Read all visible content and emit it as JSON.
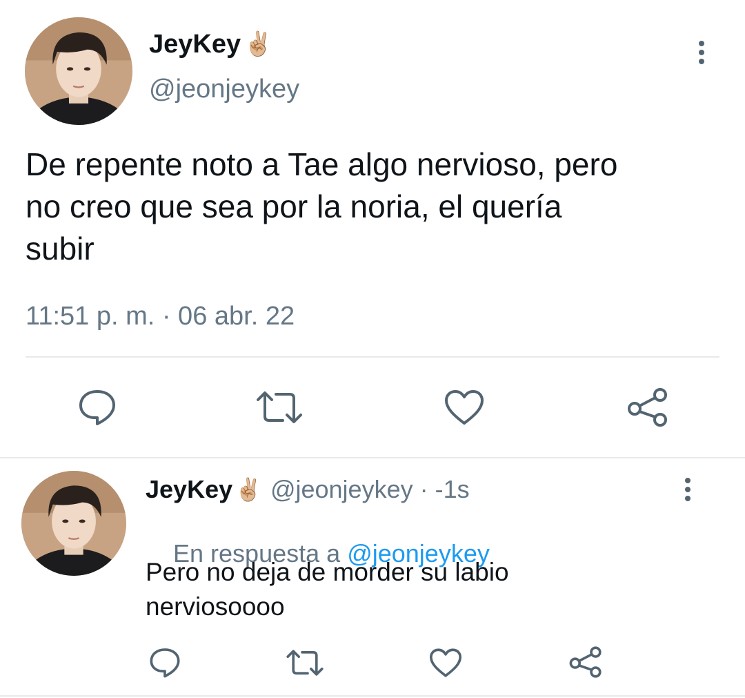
{
  "main_tweet": {
    "display_name": "JeyKey",
    "name_emoji": "✌🏼",
    "handle": "@jeonjeykey",
    "text_lines": [
      "De repente noto a Tae algo nervioso, pero",
      "no creo que sea por la noria, el quería",
      "subir"
    ],
    "timestamp": "11:51 p. m. · 06 abr. 22"
  },
  "reply_tweet": {
    "display_name": "JeyKey",
    "name_emoji": "✌🏼",
    "handle": "@jeonjeykey",
    "time": " · -1s",
    "in_reply_prefix": "En respuesta a ",
    "in_reply_handle": "@jeonjeykey",
    "text_lines": [
      "Pero no deja de morder su labio",
      "nerviosoooo"
    ]
  },
  "icons": [
    "reply-icon",
    "retweet-icon",
    "like-icon",
    "share-icon",
    "more-options-icon"
  ],
  "colors": {
    "text": "#0f1419",
    "muted": "#657786",
    "link": "#1d9bf0",
    "icon": "#536471",
    "divider": "#e7e9eb"
  }
}
